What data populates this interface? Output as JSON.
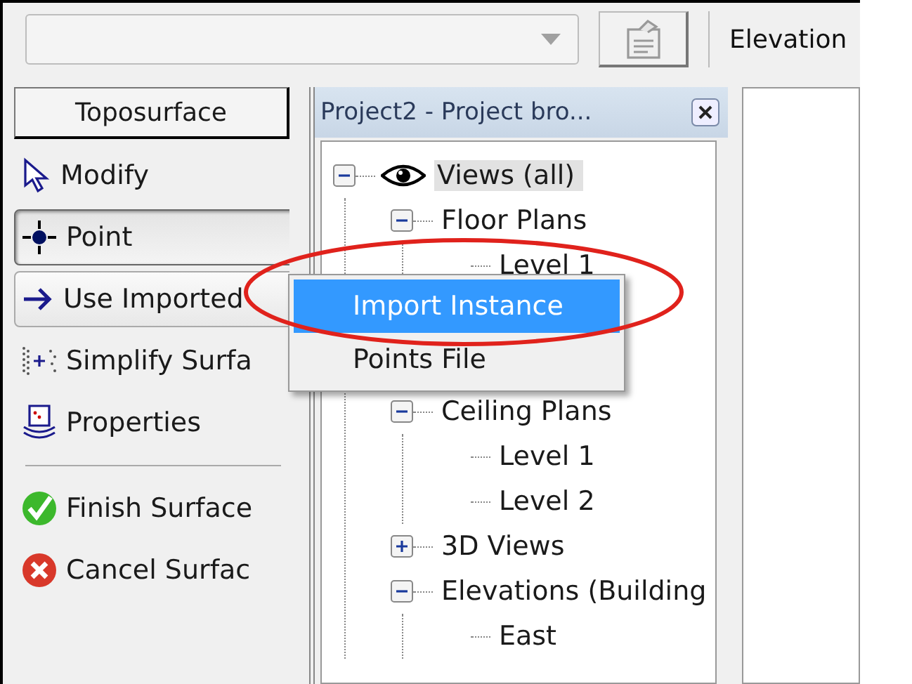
{
  "view_tab": {
    "label": "Elevation"
  },
  "design_bar": {
    "title": "Toposurface",
    "tools": [
      {
        "label": "Modify",
        "kind": "pointer",
        "selected": false,
        "open": false
      },
      {
        "label": "Point",
        "kind": "point",
        "selected": true,
        "open": false
      },
      {
        "label": "Use Imported",
        "kind": "arrow",
        "selected": false,
        "open": true
      },
      {
        "label": "Simplify Surfa",
        "kind": "simplify",
        "selected": false,
        "open": false
      },
      {
        "label": "Properties",
        "kind": "properties",
        "selected": false,
        "open": false
      }
    ],
    "actions": [
      {
        "label": "Finish Surface",
        "kind": "finish"
      },
      {
        "label": "Cancel Surfac",
        "kind": "cancel"
      }
    ]
  },
  "project_browser": {
    "title": "Project2 - Project bro...",
    "nodes": [
      {
        "label": "Views (all)",
        "expanded": true,
        "selected": true,
        "children": [
          {
            "label": "Floor Plans",
            "expanded": true,
            "selected": false,
            "children": [
              {
                "label": "Level 1",
                "selected": false
              }
            ]
          },
          {
            "label": "Ceiling Plans",
            "expanded": true,
            "selected": false,
            "children": [
              {
                "label": "Level 1",
                "selected": false
              },
              {
                "label": "Level 2",
                "selected": false
              }
            ]
          },
          {
            "label": "3D Views",
            "expanded": false,
            "selected": false
          },
          {
            "label": "Elevations (Building",
            "expanded": true,
            "selected": false,
            "children": [
              {
                "label": "East",
                "selected": false
              }
            ]
          }
        ]
      }
    ]
  },
  "context_menu": {
    "items": [
      {
        "label": "Import Instance",
        "selected": true
      },
      {
        "label": "Points File",
        "selected": false
      }
    ]
  }
}
